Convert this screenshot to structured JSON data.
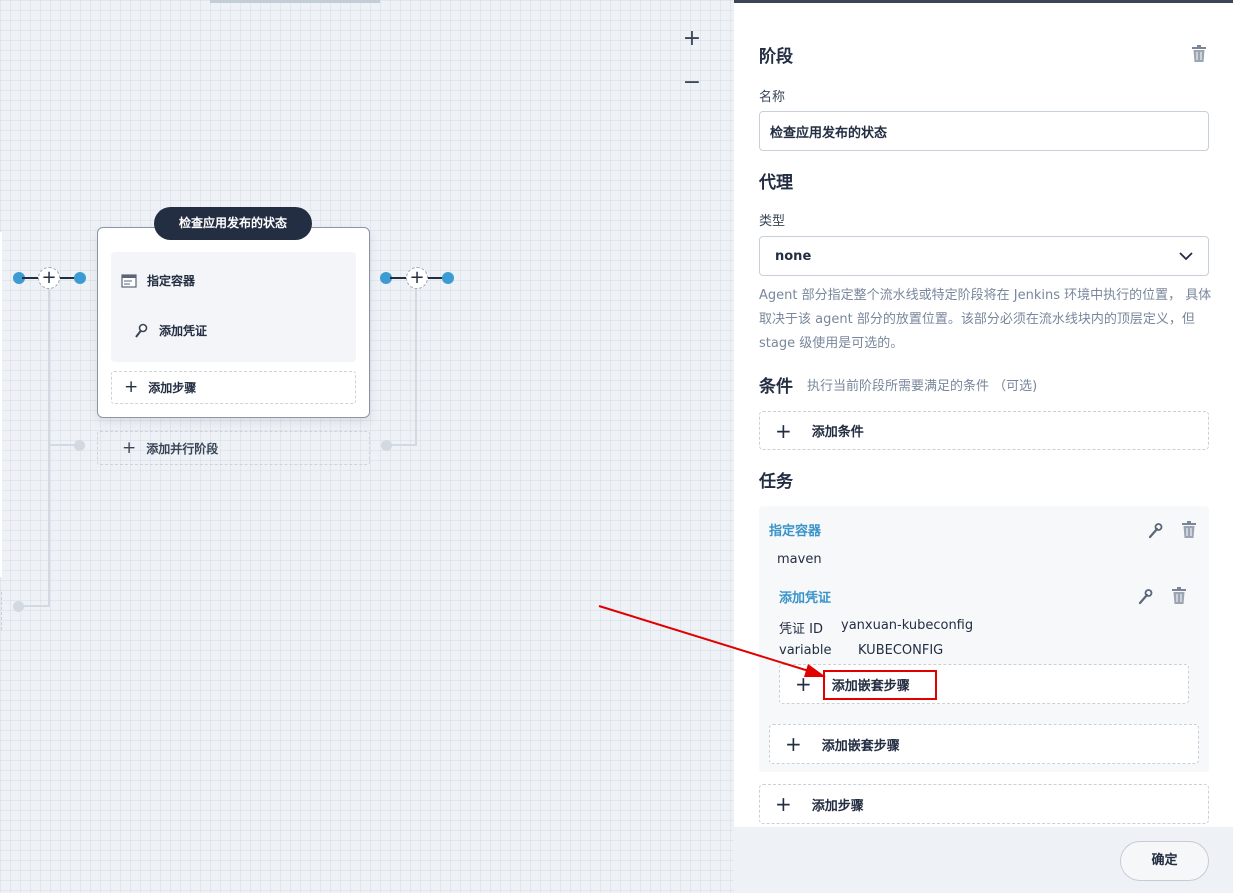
{
  "canvas": {
    "zoom_in": "+",
    "zoom_out": "−",
    "stage": {
      "name": "检查应用发布的状态",
      "steps": [
        {
          "label": "指定容器",
          "icon": "container-icon"
        },
        {
          "label": "添加凭证",
          "icon": "key-icon"
        }
      ],
      "add_step": "添加步骤"
    },
    "add_parallel": "添加并行阶段"
  },
  "panel": {
    "title": "阶段",
    "name_label": "名称",
    "name_value": "检查应用发布的状态",
    "agent_title": "代理",
    "type_label": "类型",
    "type_value": "none",
    "agent_desc": "Agent 部分指定整个流水线或特定阶段将在 Jenkins 环境中执行的位置， 具体取决于该 agent 部分的放置位置。该部分必须在流水线块内的顶层定义，但 stage 级使用是可选的。",
    "condition_title": "条件",
    "condition_desc": "执行当前阶段所需要满足的条件 （可选)",
    "add_condition": "添加条件",
    "tasks_title": "任务",
    "task": {
      "name": "指定容器",
      "value": "maven",
      "nested": {
        "name": "添加凭证",
        "credential_label": "凭证 ID",
        "credential_value": "yanxuan-kubeconfig",
        "variable_label": "variable",
        "variable_value": "KUBECONFIG",
        "add_nested_step": "添加嵌套步骤"
      },
      "add_nested_step": "添加嵌套步骤"
    },
    "add_step": "添加步骤",
    "ok_button": "确定"
  },
  "colors": {
    "accent": "#3d9bd4",
    "dark": "#242e42",
    "highlight": "#e00000",
    "link": "#3a94c9"
  }
}
